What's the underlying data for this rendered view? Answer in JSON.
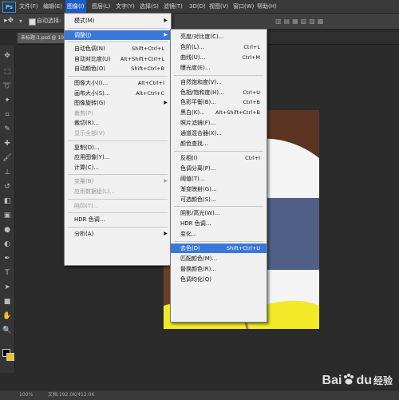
{
  "menubar": {
    "logo": "Ps",
    "items": [
      "文件(F)",
      "编辑(E)",
      "图像(I)",
      "图层(L)",
      "文字(Y)",
      "选择(S)",
      "滤镜(T)",
      "3D(D)",
      "视图(V)",
      "窗口(W)",
      "帮助(H)"
    ]
  },
  "optbar": {
    "auto_select": "自动选择:"
  },
  "document": {
    "tab": "未标题-1.psd @ 100%"
  },
  "image_menu": [
    {
      "label": "模式(M)",
      "arrow": true
    },
    {
      "label": "调整(J)",
      "arrow": true,
      "highlight": true
    },
    {
      "label": "自动色调(N)",
      "shortcut": "Shift+Ctrl+L"
    },
    {
      "label": "自动对比度(U)",
      "shortcut": "Alt+Shift+Ctrl+L"
    },
    {
      "label": "自动颜色(O)",
      "shortcut": "Shift+Ctrl+B"
    },
    {
      "label": "图像大小(I)...",
      "shortcut": "Alt+Ctrl+I"
    },
    {
      "label": "画布大小(S)...",
      "shortcut": "Alt+Ctrl+C"
    },
    {
      "label": "图像旋转(G)",
      "arrow": true
    },
    {
      "label": "裁剪(P)",
      "disabled": true
    },
    {
      "label": "裁切(R)..."
    },
    {
      "label": "显示全部(V)",
      "disabled": true
    },
    {
      "label": "复制(D)..."
    },
    {
      "label": "应用图像(Y)..."
    },
    {
      "label": "计算(C)..."
    },
    {
      "label": "变量(B)",
      "arrow": true,
      "disabled": true
    },
    {
      "label": "应用数据组(L)...",
      "disabled": true
    },
    {
      "label": "陷印(T)...",
      "disabled": true
    },
    {
      "label": "HDR 色调..."
    },
    {
      "label": "分析(A)",
      "arrow": true
    }
  ],
  "adjust_menu": [
    {
      "label": "亮度/对比度(C)..."
    },
    {
      "label": "色阶(L)...",
      "shortcut": "Ctrl+L"
    },
    {
      "label": "曲线(U)...",
      "shortcut": "Ctrl+M"
    },
    {
      "label": "曝光度(E)..."
    },
    {
      "label": "自然饱和度(V)..."
    },
    {
      "label": "色相/饱和度(H)...",
      "shortcut": "Ctrl+U"
    },
    {
      "label": "色彩平衡(B)...",
      "shortcut": "Ctrl+B"
    },
    {
      "label": "黑白(K)...",
      "shortcut": "Alt+Shift+Ctrl+B"
    },
    {
      "label": "照片滤镜(F)..."
    },
    {
      "label": "通道混合器(X)..."
    },
    {
      "label": "颜色查找..."
    },
    {
      "label": "反相(I)",
      "shortcut": "Ctrl+I"
    },
    {
      "label": "色调分离(P)..."
    },
    {
      "label": "阈值(T)..."
    },
    {
      "label": "渐变映射(G)..."
    },
    {
      "label": "可选颜色(S)..."
    },
    {
      "label": "阴影/高光(W)..."
    },
    {
      "label": "HDR 色调..."
    },
    {
      "label": "变化..."
    },
    {
      "label": "去色(D)",
      "shortcut": "Shift+Ctrl+U",
      "highlight": true
    },
    {
      "label": "匹配颜色(M)..."
    },
    {
      "label": "替换颜色(R)..."
    },
    {
      "label": "色调均化(Q)"
    }
  ],
  "statusbar": {
    "zoom": "100%",
    "doc": "文档:192.0K/412.0K"
  },
  "watermark": {
    "brand_a": "Bai",
    "brand_b": "du",
    "suffix": "经验"
  },
  "colors": {
    "highlight": "#3a78d8",
    "menu_active": "#1e5bc6",
    "shirt": "#f2ea27"
  }
}
